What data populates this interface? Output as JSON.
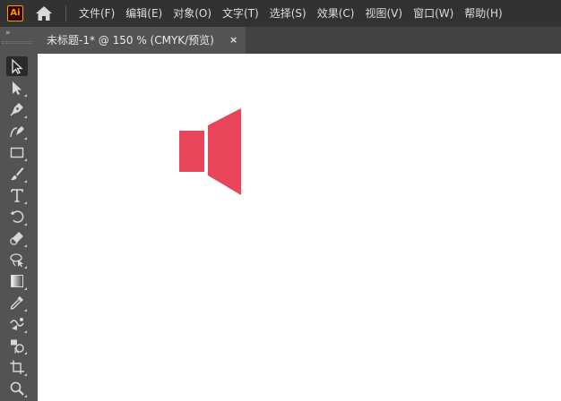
{
  "app": {
    "logo_text": "Ai",
    "logo_color": "#ff9a00"
  },
  "menu": {
    "items": [
      "文件(F)",
      "编辑(E)",
      "对象(O)",
      "文字(T)",
      "选择(S)",
      "效果(C)",
      "视图(V)",
      "窗口(W)",
      "帮助(H)"
    ]
  },
  "toolbar": {
    "collapse_glyph": "»",
    "tools": [
      {
        "icon": "selection-tool-icon",
        "active": true
      },
      {
        "icon": "direct-selection-tool-icon"
      },
      {
        "icon": "pen-tool-icon"
      },
      {
        "icon": "curvature-tool-icon"
      },
      {
        "icon": "rectangle-tool-icon"
      },
      {
        "icon": "paintbrush-tool-icon"
      },
      {
        "icon": "type-tool-icon"
      },
      {
        "icon": "rotate-tool-icon"
      },
      {
        "icon": "eraser-tool-icon"
      },
      {
        "icon": "lasso-tool-icon"
      },
      {
        "icon": "gradient-tool-icon"
      },
      {
        "icon": "eyedropper-tool-icon"
      },
      {
        "icon": "blend-tool-icon"
      },
      {
        "icon": "shape-builder-tool-icon"
      },
      {
        "icon": "artboard-tool-icon"
      },
      {
        "icon": "zoom-tool-icon"
      }
    ]
  },
  "document": {
    "tab_title": "未标题-1* @ 150 % (CMYK/预览)",
    "close_glyph": "×"
  },
  "artwork": {
    "shape": "speaker-icon",
    "fill": "#e8455a"
  }
}
